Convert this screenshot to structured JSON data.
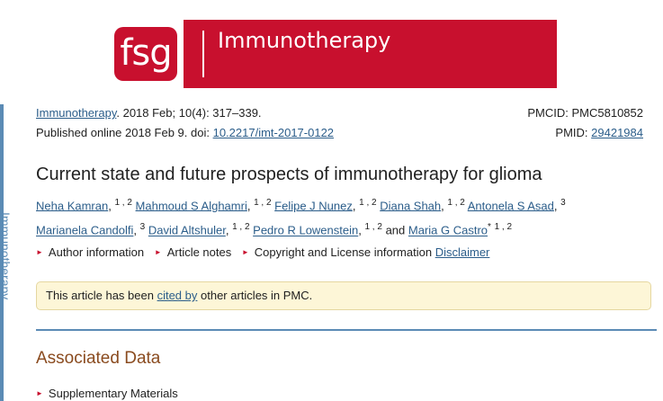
{
  "sidebar": {
    "label": "Immunotherapy"
  },
  "banner": {
    "logo_text": "fsg",
    "journal_name": "Immunotherapy"
  },
  "citation": {
    "journal_link": "Immunotherapy",
    "details": ". 2018 Feb; 10(4): 317–339.",
    "published": "Published online 2018 Feb 9. doi: ",
    "doi": "10.2217/imt-2017-0122",
    "pmcid": "PMCID: PMC5810852",
    "pmid_label": "PMID: ",
    "pmid": "29421984"
  },
  "title": "Current state and future prospects of immunotherapy for glioma",
  "authors": [
    {
      "name": "Neha Kamran",
      "aff": "1 , 2"
    },
    {
      "name": "Mahmoud S Alghamri",
      "aff": "1 , 2"
    },
    {
      "name": "Felipe J Nunez",
      "aff": "1 , 2"
    },
    {
      "name": "Diana Shah",
      "aff": "1 , 2"
    },
    {
      "name": "Antonela S Asad",
      "aff": "3"
    },
    {
      "name": "Marianela Candolfi",
      "aff": "3"
    },
    {
      "name": "David Altshuler",
      "aff": "1 , 2"
    },
    {
      "name": "Pedro R Lowenstein",
      "aff": "1 , 2"
    },
    {
      "name": "Maria G Castro",
      "aff": "1 , 2"
    }
  ],
  "authors_and": "and",
  "meta_links": {
    "author_info": "Author information",
    "article_notes": "Article notes",
    "copyright": "Copyright and License information",
    "disclaimer": "Disclaimer"
  },
  "notice": {
    "prefix": "This article has been ",
    "link": "cited by",
    "suffix": " other articles in PMC."
  },
  "section": {
    "title": "Associated Data",
    "supp": "Supplementary Materials"
  }
}
